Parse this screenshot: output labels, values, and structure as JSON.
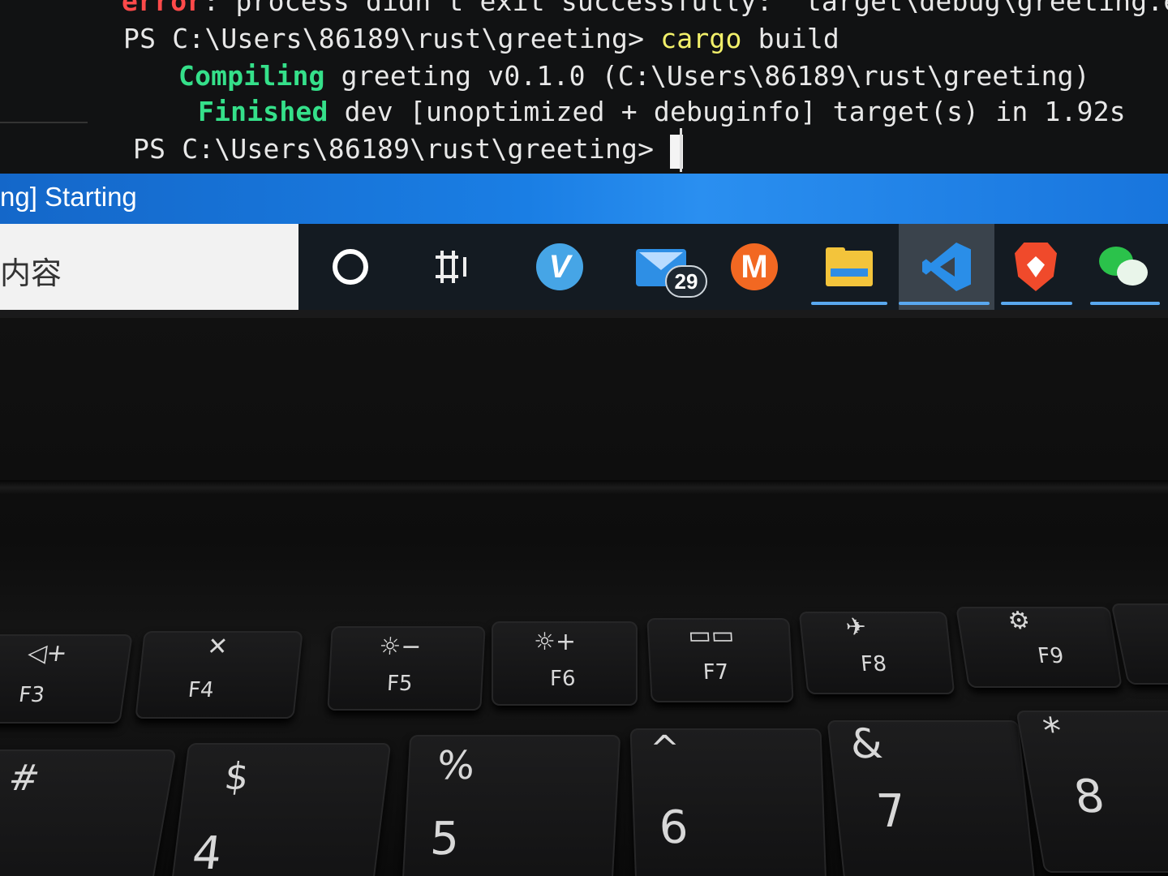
{
  "terminal": {
    "line0_error_word": "error",
    "line0_rest": ": process didn't exit successfully: `target\\debug\\greeting.ex",
    "line1_prompt": "PS C:\\Users\\86189\\rust\\greeting> ",
    "line1_cmd": "cargo",
    "line1_arg": " build",
    "line2_keyword": "Compiling",
    "line2_rest": " greeting v0.1.0 (C:\\Users\\86189\\rust\\greeting)",
    "line3_keyword": "Finished",
    "line3_rest": " dev [unoptimized + debuginfo] target(s) in 1.92s",
    "line4_prompt": "PS C:\\Users\\86189\\rust\\greeting> "
  },
  "statusbar": {
    "text": "ng] Starting"
  },
  "taskbar": {
    "search_placeholder": "内容",
    "apps": [
      {
        "name": "cortana",
        "icon": "circle-icon"
      },
      {
        "name": "task-view",
        "icon": "task-view-icon"
      },
      {
        "name": "vivaldi",
        "icon": "vivaldi-icon",
        "glyph": "V"
      },
      {
        "name": "mail",
        "icon": "mail-icon",
        "badge": "29"
      },
      {
        "name": "monero",
        "icon": "monero-icon",
        "glyph": "M"
      },
      {
        "name": "file-explorer",
        "icon": "folder-icon"
      },
      {
        "name": "vscode",
        "icon": "vscode-icon",
        "active": true
      },
      {
        "name": "brave",
        "icon": "brave-lion-icon"
      },
      {
        "name": "wechat",
        "icon": "wechat-icon"
      }
    ]
  },
  "keyboard": {
    "fkeys": [
      {
        "label": "F3",
        "sym": "◁+"
      },
      {
        "label": "F4",
        "sym": "✕"
      },
      {
        "label": "F5",
        "sym": "☼−"
      },
      {
        "label": "F6",
        "sym": "☼+"
      },
      {
        "label": "F7",
        "sym": "▭▭"
      },
      {
        "label": "F8",
        "sym": "✈"
      },
      {
        "label": "F9",
        "sym": "⚙"
      }
    ],
    "numkeys": [
      {
        "top": "#",
        "bottom": ""
      },
      {
        "top": "$",
        "bottom": "4"
      },
      {
        "top": "%",
        "bottom": "5"
      },
      {
        "top": "^",
        "bottom": "6"
      },
      {
        "top": "&",
        "bottom": "7"
      },
      {
        "top": "*",
        "bottom": "8"
      }
    ]
  },
  "colors": {
    "terminal_bg": "#111213",
    "error_red": "#ff4a4a",
    "compile_green": "#35e08a",
    "cmd_yellow": "#f2f06a",
    "statusbar_blue": "#1a7ee4",
    "taskbar_bg": "#141b22"
  }
}
